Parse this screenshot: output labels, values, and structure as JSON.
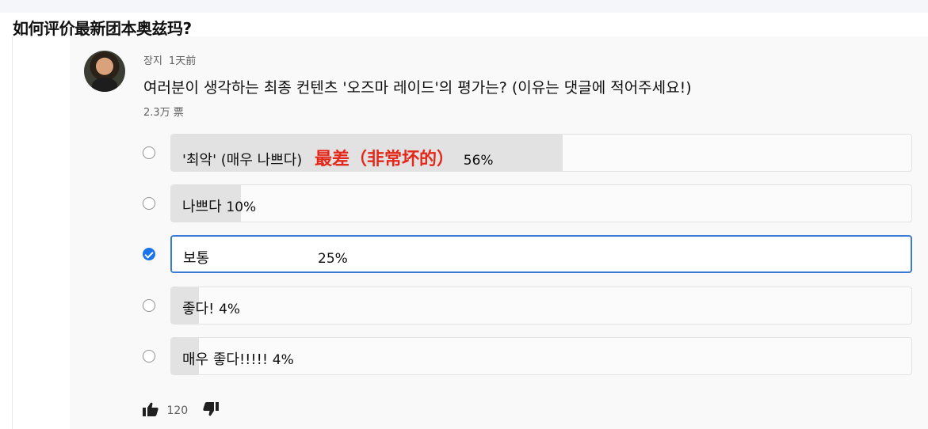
{
  "question": {
    "title": "如何评价最新团本奥兹玛?"
  },
  "post": {
    "author": "장지",
    "time": "1天前",
    "poll_question": "여러분이 생각하는 최종 컨텐츠 '오즈마 레이드'의 평가는? (이유는 댓글에 적어주세요!)",
    "votes": "2.3万 票"
  },
  "poll": {
    "options": [
      {
        "label": "'최악' (매우 나쁘다)",
        "annotation": "最差（非常坏的）",
        "percent_label": "56%",
        "percent": 56,
        "selected": false
      },
      {
        "label": "나쁘다",
        "percent_label": "10%",
        "percent": 10,
        "selected": false
      },
      {
        "label": "보통",
        "percent_label": "25%",
        "percent": 25,
        "selected": true
      },
      {
        "label": "좋다!",
        "percent_label": "4%",
        "percent": 4,
        "selected": false
      },
      {
        "label": "매우 좋다!!!!!",
        "percent_label": "4%",
        "percent": 4,
        "selected": false
      }
    ]
  },
  "actions": {
    "likes": "120",
    "like_icon": "thumbs-up-icon",
    "dislike_icon": "thumbs-down-icon"
  },
  "colors": {
    "selected": "#1a73e8",
    "annotation": "#e5271a",
    "bar_fill": "#e2e2e2"
  }
}
